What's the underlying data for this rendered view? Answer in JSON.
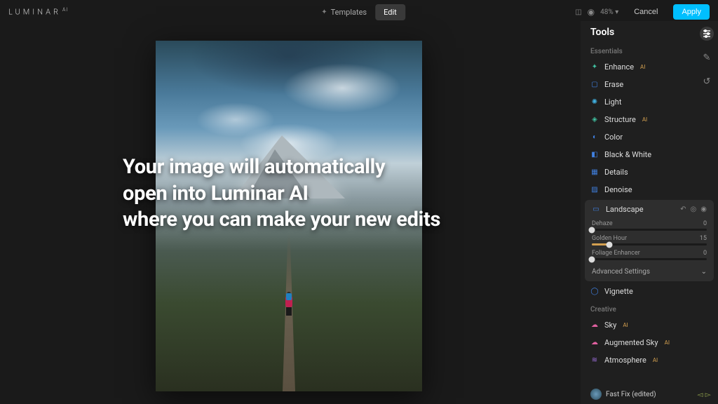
{
  "app": {
    "name": "LUMINAR",
    "suffix": "AI"
  },
  "topbar": {
    "tabs": {
      "templates": "Templates",
      "edit": "Edit"
    },
    "compare": "◫",
    "zoom": "48%",
    "cancel": "Cancel",
    "apply": "Apply"
  },
  "overlay": {
    "line1": "Your image will automatically",
    "line2": "open into Luminar AI",
    "line3": "where you can make your new edits"
  },
  "panel": {
    "title": "Tools",
    "sections": {
      "essentials": "Essentials",
      "creative": "Creative"
    },
    "tools": {
      "enhance": "Enhance",
      "erase": "Erase",
      "light": "Light",
      "structure": "Structure",
      "color": "Color",
      "bw": "Black & White",
      "details": "Details",
      "denoise": "Denoise",
      "landscape": "Landscape",
      "vignette": "Vignette",
      "sky": "Sky",
      "augsky": "Augmented Sky",
      "atmosphere": "Atmosphere"
    },
    "landscape": {
      "dehaze_label": "Dehaze",
      "dehaze_value": "0",
      "golden_label": "Golden Hour",
      "golden_value": "15",
      "foliage_label": "Foliage Enhancer",
      "foliage_value": "0",
      "advanced": "Advanced Settings"
    },
    "ai_badge": "AI"
  },
  "preset": {
    "name": "Fast Fix (edited)"
  }
}
